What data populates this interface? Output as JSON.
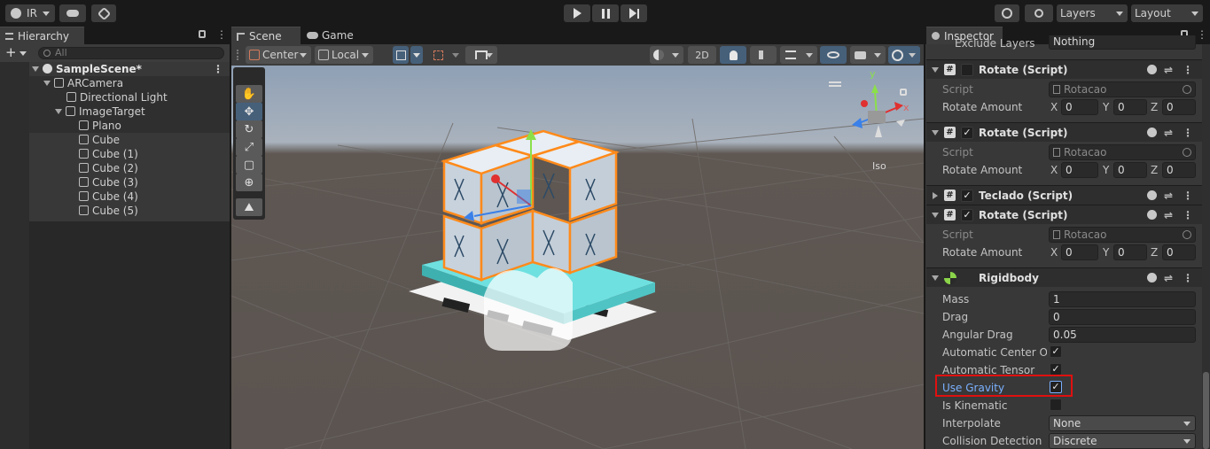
{
  "toolbar": {
    "account_label": "IR",
    "layers_label": "Layers",
    "layout_label": "Layout"
  },
  "hierarchy": {
    "tab_label": "Hierarchy",
    "search_placeholder": "All",
    "items": [
      {
        "label": "SampleScene*"
      },
      {
        "label": "ARCamera"
      },
      {
        "label": "Directional Light"
      },
      {
        "label": "ImageTarget"
      },
      {
        "label": "Plano"
      },
      {
        "label": "Cube"
      },
      {
        "label": "Cube (1)"
      },
      {
        "label": "Cube (2)"
      },
      {
        "label": "Cube (3)"
      },
      {
        "label": "Cube (4)"
      },
      {
        "label": "Cube (5)"
      }
    ]
  },
  "scene": {
    "tab_scene": "Scene",
    "tab_game": "Game",
    "pivot_center": "Center",
    "pivot_local": "Local",
    "mode_2d": "2D",
    "gizmo_label": "Iso",
    "gizmo_y": "y",
    "gizmo_x": "x"
  },
  "inspector": {
    "tab_label": "Inspector",
    "exclude_layers_label": "Exclude Layers",
    "exclude_layers_value": "Nothing",
    "components": [
      {
        "title": "Rotate (Script)",
        "enabled": false,
        "script_label": "Script",
        "script_value": "Rotacao",
        "rot_label": "Rotate Amount",
        "x": "0",
        "y": "0",
        "z": "0"
      },
      {
        "title": "Rotate (Script)",
        "enabled": true,
        "script_label": "Script",
        "script_value": "Rotacao",
        "rot_label": "Rotate Amount",
        "x": "0",
        "y": "0",
        "z": "0"
      },
      {
        "title": "Teclado (Script)",
        "enabled": true
      },
      {
        "title": "Rotate (Script)",
        "enabled": true,
        "script_label": "Script",
        "script_value": "Rotacao",
        "rot_label": "Rotate Amount",
        "x": "0",
        "y": "0",
        "z": "0"
      }
    ],
    "axis_x": "X",
    "axis_y": "Y",
    "axis_z": "Z",
    "rigidbody": {
      "title": "Rigidbody",
      "mass_label": "Mass",
      "mass": "1",
      "drag_label": "Drag",
      "drag": "0",
      "angular_drag_label": "Angular Drag",
      "angular_drag": "0.05",
      "auto_center_label": "Automatic Center Of M",
      "auto_tensor_label": "Automatic Tensor",
      "use_gravity_label": "Use Gravity",
      "is_kinematic_label": "Is Kinematic",
      "interpolate_label": "Interpolate",
      "interpolate": "None",
      "collision_label": "Collision Detection",
      "collision": "Discrete"
    },
    "highlight_color": "#e01010"
  }
}
